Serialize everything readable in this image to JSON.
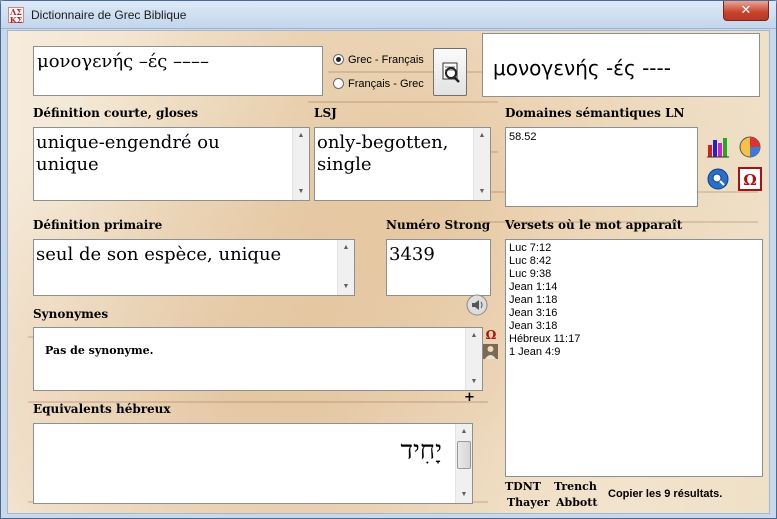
{
  "window": {
    "title": "Dictionnaire de Grec Biblique",
    "close_glyph": "✕",
    "icon_letters": "ΛΣ\nΚΣ"
  },
  "search": {
    "query": "μονογενής –ές ––––",
    "display_word": "μονογενής -ές ----",
    "mode_options": [
      "Grec - Français",
      "Français - Grec"
    ],
    "selected_mode": "Grec - Français"
  },
  "short_definition": {
    "label": "Définition courte, gloses",
    "value": "unique-engendré ou unique"
  },
  "lsj": {
    "label": "LSJ",
    "value": "only-begotten, single"
  },
  "semantic_domains": {
    "label": "Domaines sémantiques LN",
    "value": "58.52"
  },
  "primary_definition": {
    "label": "Définition primaire",
    "value": "seul de son espèce, unique"
  },
  "strong": {
    "label": "Numéro Strong",
    "value": "3439"
  },
  "verses": {
    "label": "Versets où le mot apparaît",
    "items": [
      "Luc 7:12",
      "Luc 8:42",
      "Luc 9:38",
      "Jean 1:14",
      "Jean 1:18",
      "Jean 3:16",
      "Jean 3:18",
      "Hébreux 11:17",
      "1 Jean 4:9"
    ]
  },
  "synonyms": {
    "label": "Synonymes",
    "value": "Pas de synonyme."
  },
  "hebrew": {
    "label": "Equivalents hébreux",
    "value": "יָחִיד",
    "plus_glyph": "+"
  },
  "references": {
    "tdnt": "TDNT",
    "trench": "Trench",
    "thayer": "Thayer",
    "abbott": "Abbott",
    "copy_results": "Copier les 9 résultats."
  },
  "icons": {
    "search_button": "search-icon",
    "chart": "bar-chart-icon",
    "pie": "pie-chart-icon",
    "globe": "globe-search-icon",
    "omega": "omega-icon",
    "speaker": "speaker-icon",
    "omega_small": "omega-small-icon",
    "person": "person-icon"
  },
  "colors": {
    "window_frame": "#c9d9ec",
    "close_red": "#c7432c",
    "parchment": "#f3e7d3"
  }
}
